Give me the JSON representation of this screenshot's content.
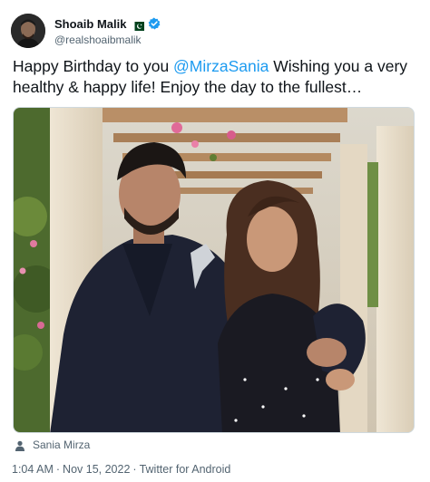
{
  "author": {
    "display_name": "Shoaib Malik",
    "handle": "@realshoaibmalik",
    "avatar_icon": "profile-photo",
    "flag_icon": "pakistan-flag-icon",
    "verified_icon": "verified-badge-icon"
  },
  "tweet": {
    "text_before": "Happy Birthday to you ",
    "mention": "@MirzaSania",
    "text_after": " Wishing you a very healthy & happy life! Enjoy the day to the fullest…"
  },
  "media": {
    "icon": "photo-couple-pergola"
  },
  "tagged": {
    "icon": "person-icon",
    "name": "Sania Mirza"
  },
  "meta": {
    "time": "1:04 AM",
    "separator": "·",
    "date": "Nov 15, 2022",
    "source": "Twitter for Android"
  },
  "colors": {
    "link": "#1d9bf0",
    "secondary_text": "#536471",
    "verified": "#1d9bf0"
  }
}
